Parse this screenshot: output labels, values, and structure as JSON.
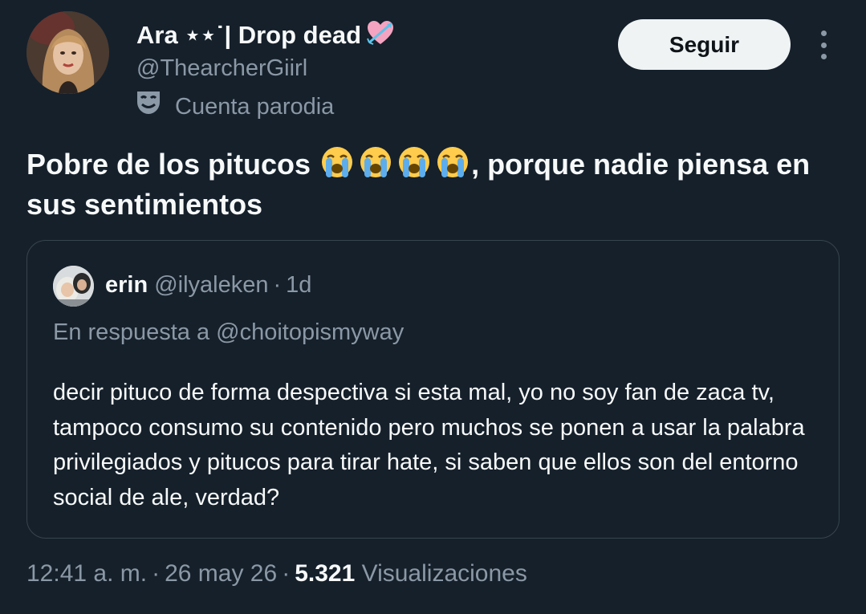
{
  "author": {
    "display_name": "Ara ⋆⋆˙| Drop dead",
    "handle": "@ThearcherGiirl",
    "label": "Cuenta parodia"
  },
  "actions": {
    "follow_label": "Seguir"
  },
  "tweet": {
    "text_before_emoji": "Pobre de los pitucos ",
    "emoji": "😭😭😭😭",
    "text_after_emoji": ", porque nadie piensa en sus sentimientos"
  },
  "quote": {
    "name": "erin",
    "handle": "@ilyaleken",
    "separator": "·",
    "time": "1d",
    "reply_to": "En respuesta a @choitopismyway",
    "body": "decir pituco de forma despectiva si esta mal, yo no soy fan de zaca tv, tampoco consumo su contenido pero muchos se ponen a usar la palabra privilegiados y pitucos para tirar hate, si saben que ellos son del entorno social de ale, verdad?"
  },
  "meta": {
    "time": "12:41 a. m.",
    "separator": "·",
    "date": "26 may 26",
    "views_count": "5.321",
    "views_label": "Visualizaciones"
  },
  "icons": {
    "heart": "heart-with-arrow-icon",
    "parody": "theater-mask-icon",
    "more": "more-vertical-icon"
  },
  "colors": {
    "background": "#15202b",
    "text_primary": "#f7f9f9",
    "text_secondary": "#8b98a5",
    "border": "#38444d",
    "button_bg": "#eff3f4",
    "heart_pink": "#f4a4c0"
  }
}
